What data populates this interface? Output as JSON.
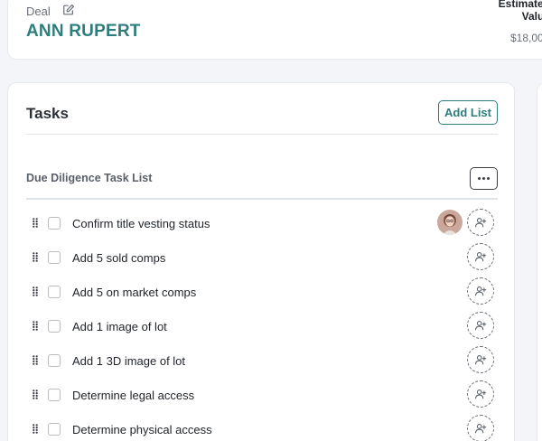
{
  "deal": {
    "label": "Deal",
    "name": "ANN RUPERT",
    "estimated_value_label": "Estimated Value",
    "estimated_value": "$18,00"
  },
  "tasks": {
    "title": "Tasks",
    "add_list_label": "Add List",
    "list": {
      "title": "Due Diligence Task List",
      "items": [
        {
          "label": "Confirm title vesting status",
          "has_avatar": true
        },
        {
          "label": "Add 5 sold comps",
          "has_avatar": false
        },
        {
          "label": "Add 5 on market comps",
          "has_avatar": false
        },
        {
          "label": "Add 1 image of lot",
          "has_avatar": false
        },
        {
          "label": "Add 1 3D image of lot",
          "has_avatar": false
        },
        {
          "label": "Determine legal access",
          "has_avatar": false
        },
        {
          "label": "Determine physical access",
          "has_avatar": false
        }
      ]
    }
  },
  "colors": {
    "accent": "#2d7d7d",
    "background": "#f4f5f8"
  }
}
